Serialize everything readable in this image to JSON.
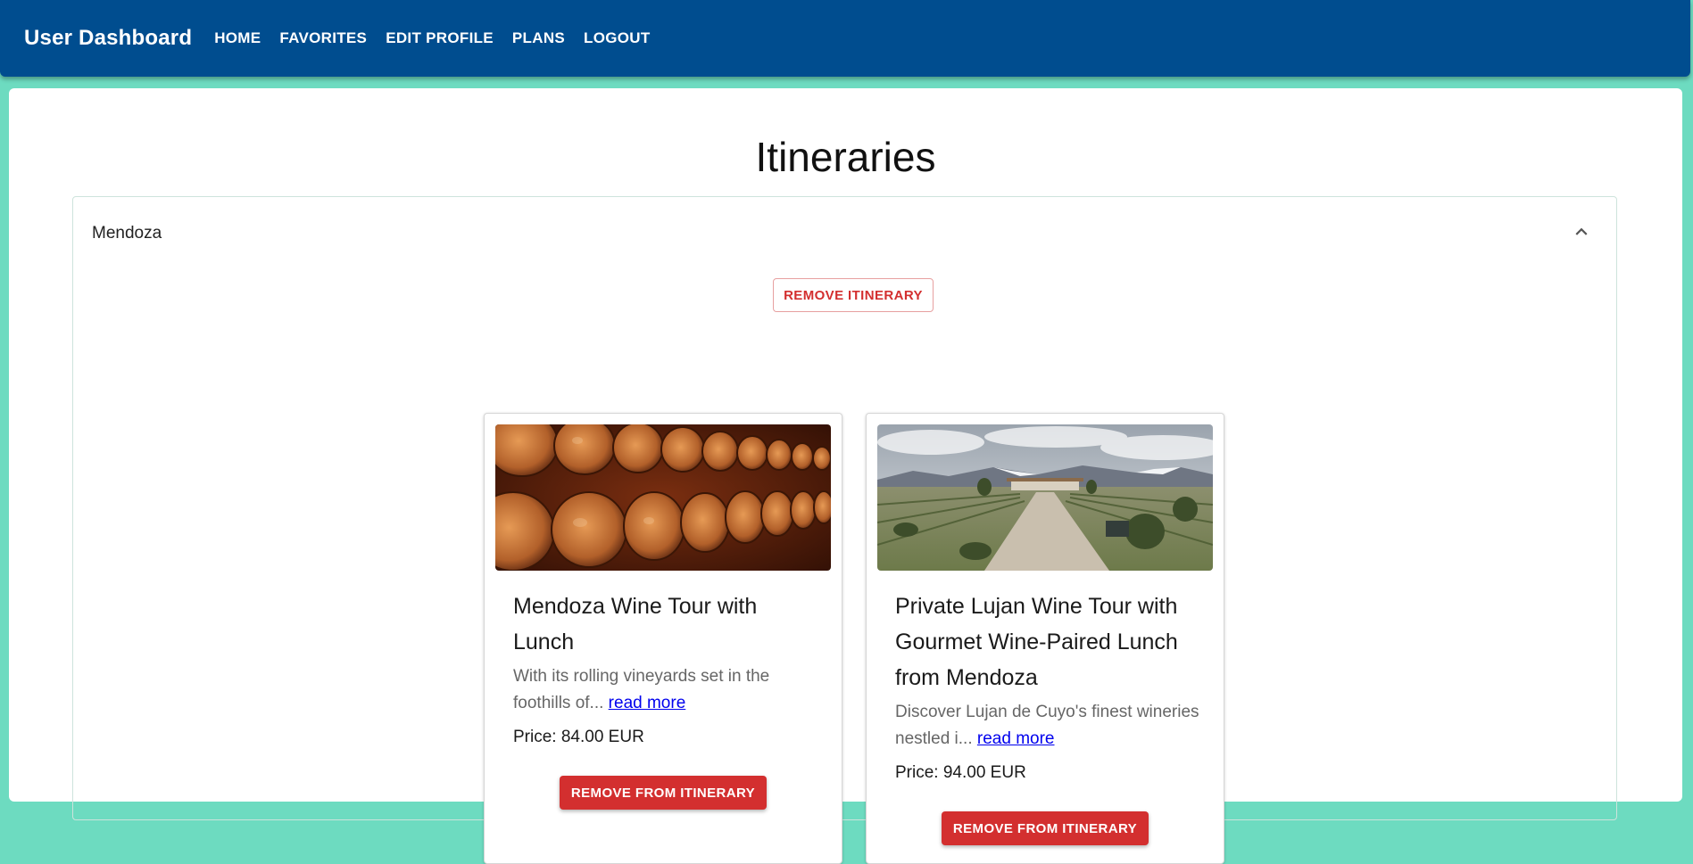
{
  "appbar": {
    "title": "User Dashboard",
    "nav": [
      "HOME",
      "FAVORITES",
      "EDIT PROFILE",
      "PLANS",
      "LOGOUT"
    ],
    "color": "#004d8f"
  },
  "page": {
    "title": "Itineraries",
    "background": "#6ddbc0"
  },
  "itinerary": {
    "name": "Mendoza",
    "expand_icon": "chevron-up-icon",
    "remove_label": "REMOVE ITINERARY",
    "tours": [
      {
        "image": "wine-barrels-image",
        "title": "Mendoza Wine Tour with Lunch",
        "description": "With its rolling vineyards set in the foothills of...",
        "read_more": "read more",
        "price": "Price: 84.00 EUR",
        "remove_label": "REMOVE FROM ITINERARY"
      },
      {
        "image": "vineyard-path-image",
        "title": "Private Lujan Wine Tour with Gourmet Wine-Paired Lunch from Mendoza",
        "description": "Discover Lujan de Cuyo's finest wineries nestled i...",
        "read_more": "read more",
        "price": "Price: 94.00 EUR",
        "remove_label": "REMOVE FROM ITINERARY"
      }
    ]
  },
  "colors": {
    "danger": "#d32f2f",
    "link": "#0000ee"
  }
}
